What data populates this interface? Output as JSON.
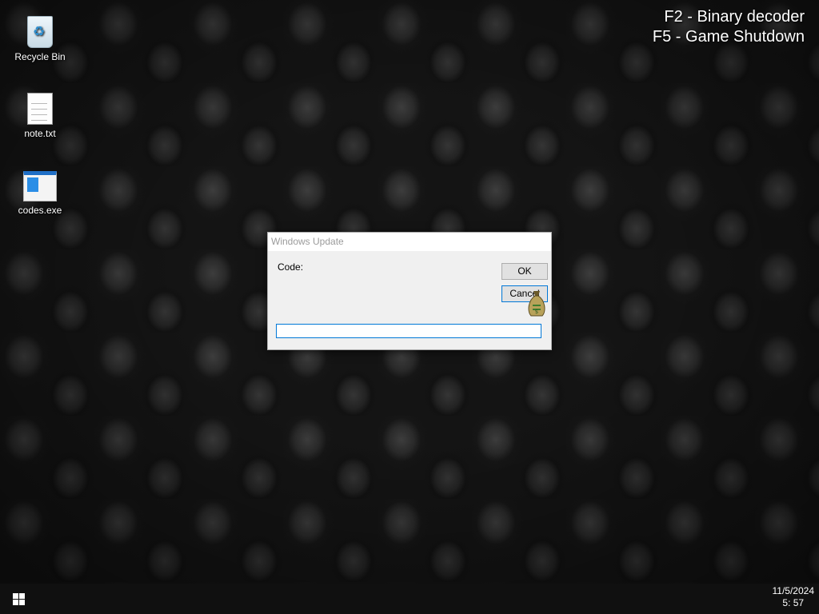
{
  "overlay": {
    "hotkey_1": "F2 - Binary decoder",
    "hotkey_2": "F5 - Game Shutdown"
  },
  "desktop": {
    "icons": [
      {
        "label": "Recycle Bin",
        "icon": "recycle-bin-icon"
      },
      {
        "label": "note.txt",
        "icon": "text-file-icon"
      },
      {
        "label": "codes.exe",
        "icon": "application-icon"
      }
    ]
  },
  "dialog": {
    "title": "Windows Update",
    "prompt": "Code:",
    "ok_label": "OK",
    "cancel_label": "Cancel",
    "input_value": ""
  },
  "taskbar": {
    "date": "11/5/2024",
    "time": "5: 57"
  },
  "colors": {
    "accent": "#0078d7",
    "taskbar": "#101010",
    "dialog_bg": "#f0f0f0"
  }
}
